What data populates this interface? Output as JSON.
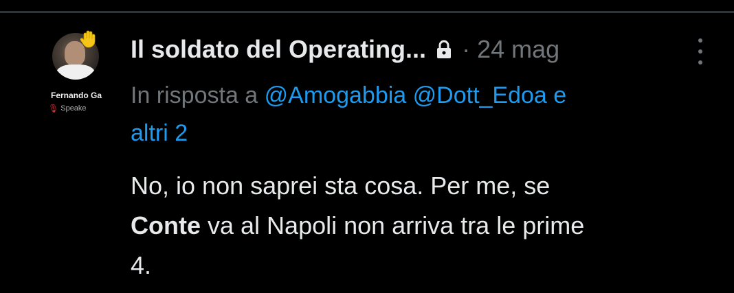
{
  "avatar": {
    "name_overlay": "Fernando Ga",
    "sub_overlay": "Speake"
  },
  "tweet": {
    "display_name": "Il soldato del Operating...",
    "separator": "·",
    "date": "24 mag",
    "reply_prefix": "In risposta a",
    "mentions": [
      "@Amogabbia",
      "@Dott_Edoa"
    ],
    "reply_conj": "e",
    "reply_others": "altri 2",
    "body_line1": "No, io non saprei sta cosa. Per me, se",
    "body_bold": "Conte",
    "body_line2_rest": " va al Napoli non arriva tra le prime",
    "body_line3": "4."
  },
  "colors": {
    "background": "#000000",
    "text_primary": "#e7e9ea",
    "text_secondary": "#71767b",
    "link": "#1d9bf0",
    "divider": "#2f3336"
  },
  "icons": {
    "lock": "lock-icon",
    "more": "more-vertical-icon",
    "hand": "raised-hand-icon",
    "mic": "microphone-icon"
  }
}
